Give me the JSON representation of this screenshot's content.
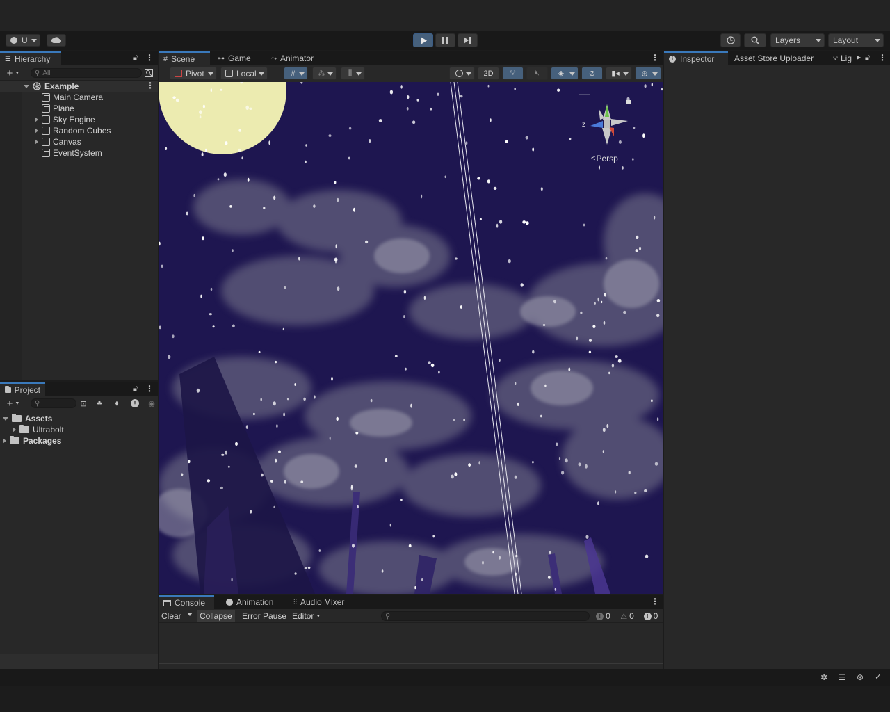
{
  "toolbar": {
    "account_label": "U",
    "play_icon": "play-icon",
    "pause_icon": "pause-icon",
    "step_icon": "step-icon",
    "layers_label": "Layers",
    "layout_label": "Layout"
  },
  "hierarchy": {
    "tab_label": "Hierarchy",
    "search_placeholder": "All",
    "scene_name": "Example",
    "items": [
      {
        "label": "Main Camera",
        "expandable": false
      },
      {
        "label": "Plane",
        "expandable": false
      },
      {
        "label": "Sky Engine",
        "expandable": true
      },
      {
        "label": "Random Cubes",
        "expandable": true
      },
      {
        "label": "Canvas",
        "expandable": true
      },
      {
        "label": "EventSystem",
        "expandable": false
      }
    ]
  },
  "project": {
    "tab_label": "Project",
    "badge_count": "",
    "tree": [
      {
        "label": "Assets",
        "bold": true
      },
      {
        "label": "Ultrabolt",
        "bold": false
      },
      {
        "label": "Packages",
        "bold": true
      }
    ]
  },
  "scene_view": {
    "tabs": [
      "Scene",
      "Game",
      "Animator"
    ],
    "active_tab": "Scene",
    "pivot_label": "Pivot",
    "local_label": "Local",
    "mode_2d_label": "2D",
    "gizmo_axis_label": "z",
    "persp_label": "Persp",
    "sky_color": "#1e1650",
    "moon_color": "#ecebb0"
  },
  "inspector": {
    "tabs": [
      "Inspector",
      "Asset Store Uploader",
      "Lig"
    ]
  },
  "console": {
    "tabs": [
      "Console",
      "Animation",
      "Audio Mixer"
    ],
    "clear_label": "Clear",
    "collapse_label": "Collapse",
    "error_pause_label": "Error Pause",
    "editor_label": "Editor",
    "info_count": "0",
    "warning_count": "0",
    "error_count": "0"
  }
}
